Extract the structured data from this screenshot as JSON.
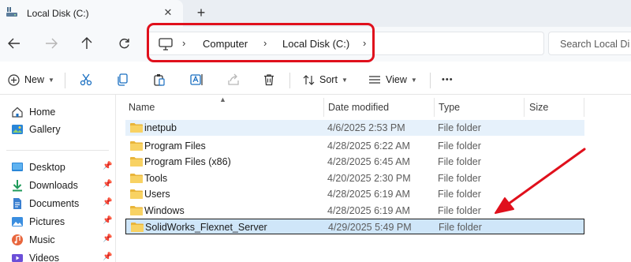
{
  "tab": {
    "title": "Local Disk (C:)",
    "close_glyph": "✕",
    "new_glyph": "+"
  },
  "address": {
    "breadcrumbs": [
      "Computer",
      "Local Disk (C:)"
    ],
    "search_placeholder": "Search Local Di"
  },
  "commands": {
    "new_label": "New",
    "sort_label": "Sort",
    "view_label": "View",
    "more_glyph": "•••"
  },
  "sidebar": {
    "items": [
      {
        "label": "Home",
        "icon": "home-icon",
        "pinned": false
      },
      {
        "label": "Gallery",
        "icon": "gallery-icon",
        "pinned": false
      },
      {
        "label": "Desktop",
        "icon": "desktop-icon",
        "pinned": true
      },
      {
        "label": "Downloads",
        "icon": "downloads-icon",
        "pinned": true
      },
      {
        "label": "Documents",
        "icon": "documents-icon",
        "pinned": true
      },
      {
        "label": "Pictures",
        "icon": "pictures-icon",
        "pinned": true
      },
      {
        "label": "Music",
        "icon": "music-icon",
        "pinned": true
      },
      {
        "label": "Videos",
        "icon": "videos-icon",
        "pinned": true
      }
    ]
  },
  "list": {
    "columns": [
      "Name",
      "Date modified",
      "Type",
      "Size"
    ],
    "rows": [
      {
        "name": "inetpub",
        "date": "4/6/2025 2:53 PM",
        "type": "File folder",
        "state": "hover"
      },
      {
        "name": "Program Files",
        "date": "4/28/2025 6:22 AM",
        "type": "File folder",
        "state": ""
      },
      {
        "name": "Program Files (x86)",
        "date": "4/28/2025 6:45 AM",
        "type": "File folder",
        "state": ""
      },
      {
        "name": "Tools",
        "date": "4/20/2025 2:30 PM",
        "type": "File folder",
        "state": ""
      },
      {
        "name": "Users",
        "date": "4/28/2025 6:19 AM",
        "type": "File folder",
        "state": ""
      },
      {
        "name": "Windows",
        "date": "4/28/2025 6:19 AM",
        "type": "File folder",
        "state": ""
      },
      {
        "name": "SolidWorks_Flexnet_Server",
        "date": "4/29/2025 5:49 PM",
        "type": "File folder",
        "state": "selected"
      }
    ]
  },
  "colors": {
    "annotation_red": "#e0101c",
    "hover_row": "#e6f1fb",
    "selected_row": "#cfe6f9",
    "folder_yellow": "#f4c94e"
  }
}
